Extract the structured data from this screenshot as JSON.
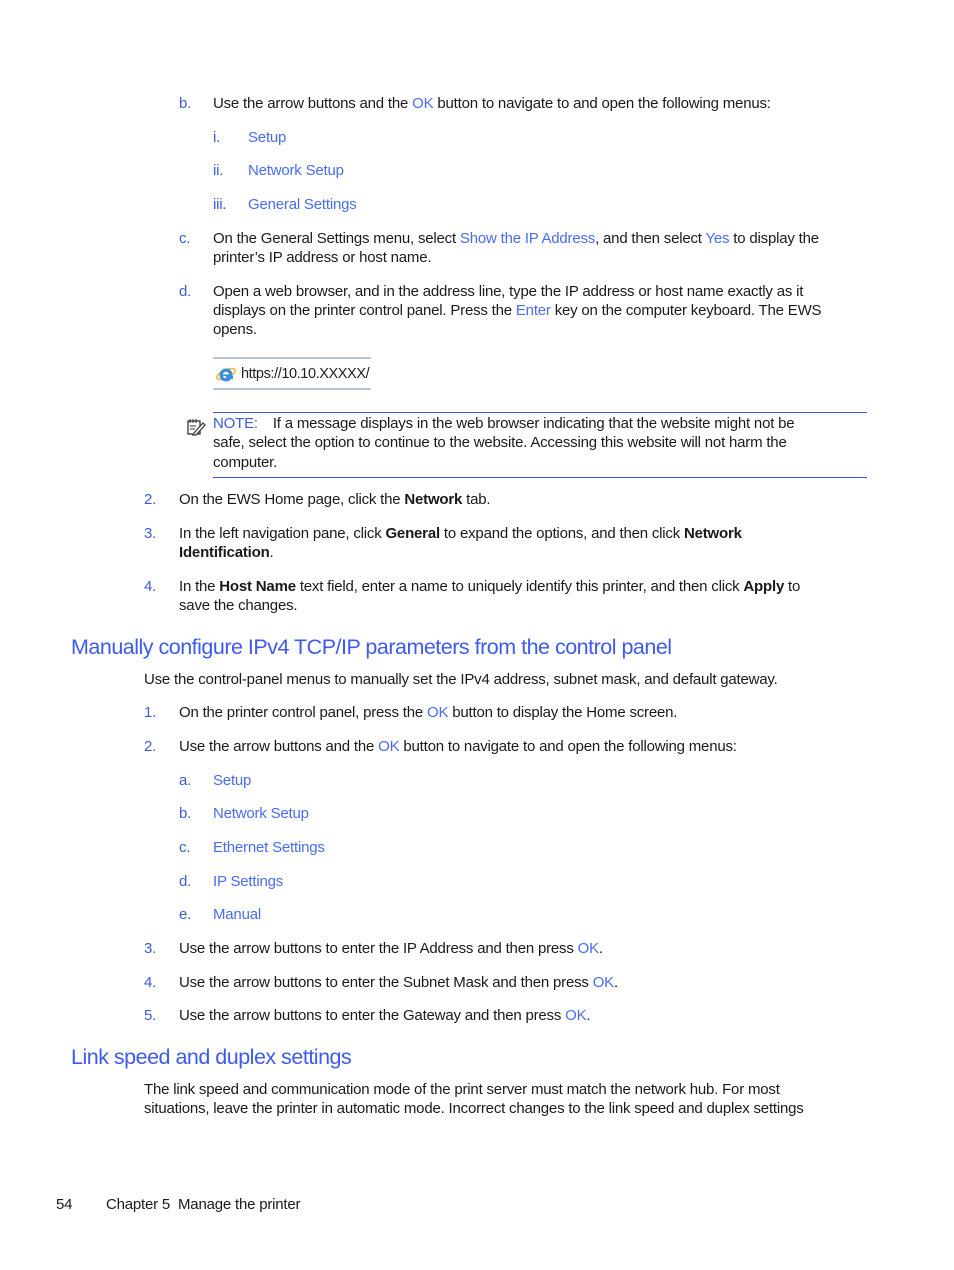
{
  "steps_top": {
    "b": {
      "label": "b.",
      "pre": "Use the arrow buttons and the ",
      "ok": "OK",
      "post": " button to navigate to and open the following menus:"
    },
    "submenus": [
      {
        "label": "i.",
        "text": "Setup"
      },
      {
        "label": "ii.",
        "text": "Network Setup"
      },
      {
        "label": "iii.",
        "text": "General Settings"
      }
    ],
    "c": {
      "label": "c.",
      "pre": "On the General Settings menu, select ",
      "link1": "Show the IP Address",
      "mid": ", and then select ",
      "link2": "Yes",
      "post": " to display the",
      "line2": "printer’s IP address or host name."
    },
    "d": {
      "label": "d.",
      "line1": "Open a web browser, and in the address line, type the IP address or host name exactly as it",
      "pre2": "displays on the printer control panel. Press the ",
      "enter": "Enter",
      "post2": " key on the computer keyboard. The EWS",
      "line3": "opens."
    },
    "url_example": "https://10.10.XXXXX/",
    "note": {
      "label": "NOTE:",
      "line1": "If a message displays in the web browser indicating that the website might not be",
      "line2": "safe, select the option to continue to the website. Accessing this website will not harm the",
      "line3": "computer."
    }
  },
  "steps_main": [
    {
      "label": "2.",
      "pre": "On the EWS Home page, click the ",
      "bold": "Network",
      "post": " tab."
    },
    {
      "label": "3.",
      "pre": "In the left navigation pane, click ",
      "bold1": "General",
      "mid": " to expand the options, and then click ",
      "bold2": "Network",
      "bold3": "Identification",
      "post": "."
    },
    {
      "label": "4.",
      "pre": "In the ",
      "bold1": "Host Name",
      "mid": " text field, enter a name to uniquely identify this printer, and then click ",
      "bold2": "Apply",
      "post": " to",
      "line2": "save the changes."
    }
  ],
  "section_ipv4": {
    "title": "Manually configure IPv4 TCP/IP parameters from the control panel",
    "intro": "Use the control-panel menus to manually set the IPv4 address, subnet mask, and default gateway.",
    "step1": {
      "label": "1.",
      "pre": "On the printer control panel, press the ",
      "ok": "OK",
      "post": " button to display the Home screen."
    },
    "step2": {
      "label": "2.",
      "pre": "Use the arrow buttons and the ",
      "ok": "OK",
      "post": " button to navigate to and open the following menus:"
    },
    "menus": [
      {
        "label": "a.",
        "text": "Setup"
      },
      {
        "label": "b.",
        "text": "Network Setup"
      },
      {
        "label": "c.",
        "text": "Ethernet Settings"
      },
      {
        "label": "d.",
        "text": "IP Settings"
      },
      {
        "label": "e.",
        "text": "Manual"
      }
    ],
    "step3": {
      "label": "3.",
      "pre": "Use the arrow buttons to enter the IP Address and then press ",
      "ok": "OK",
      "post": "."
    },
    "step4": {
      "label": "4.",
      "pre": "Use the arrow buttons to enter the Subnet Mask and then press ",
      "ok": "OK",
      "post": "."
    },
    "step5": {
      "label": "5.",
      "pre": "Use the arrow buttons to enter the Gateway and then press ",
      "ok": "OK",
      "post": "."
    }
  },
  "section_link": {
    "title": "Link speed and duplex settings",
    "line1": "The link speed and communication mode of the print server must match the network hub. For most",
    "line2": "situations, leave the printer in automatic mode. Incorrect changes to the link speed and duplex settings"
  },
  "footer": {
    "page_number": "54",
    "chapter": "Chapter 5  Manage the printer"
  }
}
